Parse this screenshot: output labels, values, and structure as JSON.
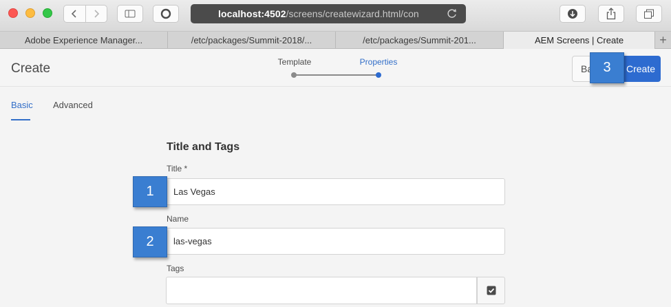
{
  "browser": {
    "url_host": "localhost:4502",
    "url_path": "/screens/createwizard.html/con",
    "tabs": [
      {
        "label": "Adobe Experience Manager..."
      },
      {
        "label": "/etc/packages/Summit-2018/..."
      },
      {
        "label": "/etc/packages/Summit-201..."
      },
      {
        "label": "AEM Screens | Create"
      }
    ],
    "new_tab_label": "+"
  },
  "header": {
    "title": "Create",
    "steps": [
      {
        "label": "Template"
      },
      {
        "label": "Properties"
      }
    ],
    "back_label": "Ba",
    "create_label": "Create"
  },
  "callouts": {
    "one": "1",
    "two": "2",
    "three": "3"
  },
  "subtabs": {
    "basic": "Basic",
    "advanced": "Advanced"
  },
  "form": {
    "section_title": "Title and Tags",
    "title_label": "Title *",
    "title_value": "Las Vegas",
    "name_label": "Name",
    "name_value": "las-vegas",
    "tags_label": "Tags",
    "tags_value": ""
  },
  "colors": {
    "accent": "#2d6bd0",
    "callout": "#3a7ed1"
  }
}
